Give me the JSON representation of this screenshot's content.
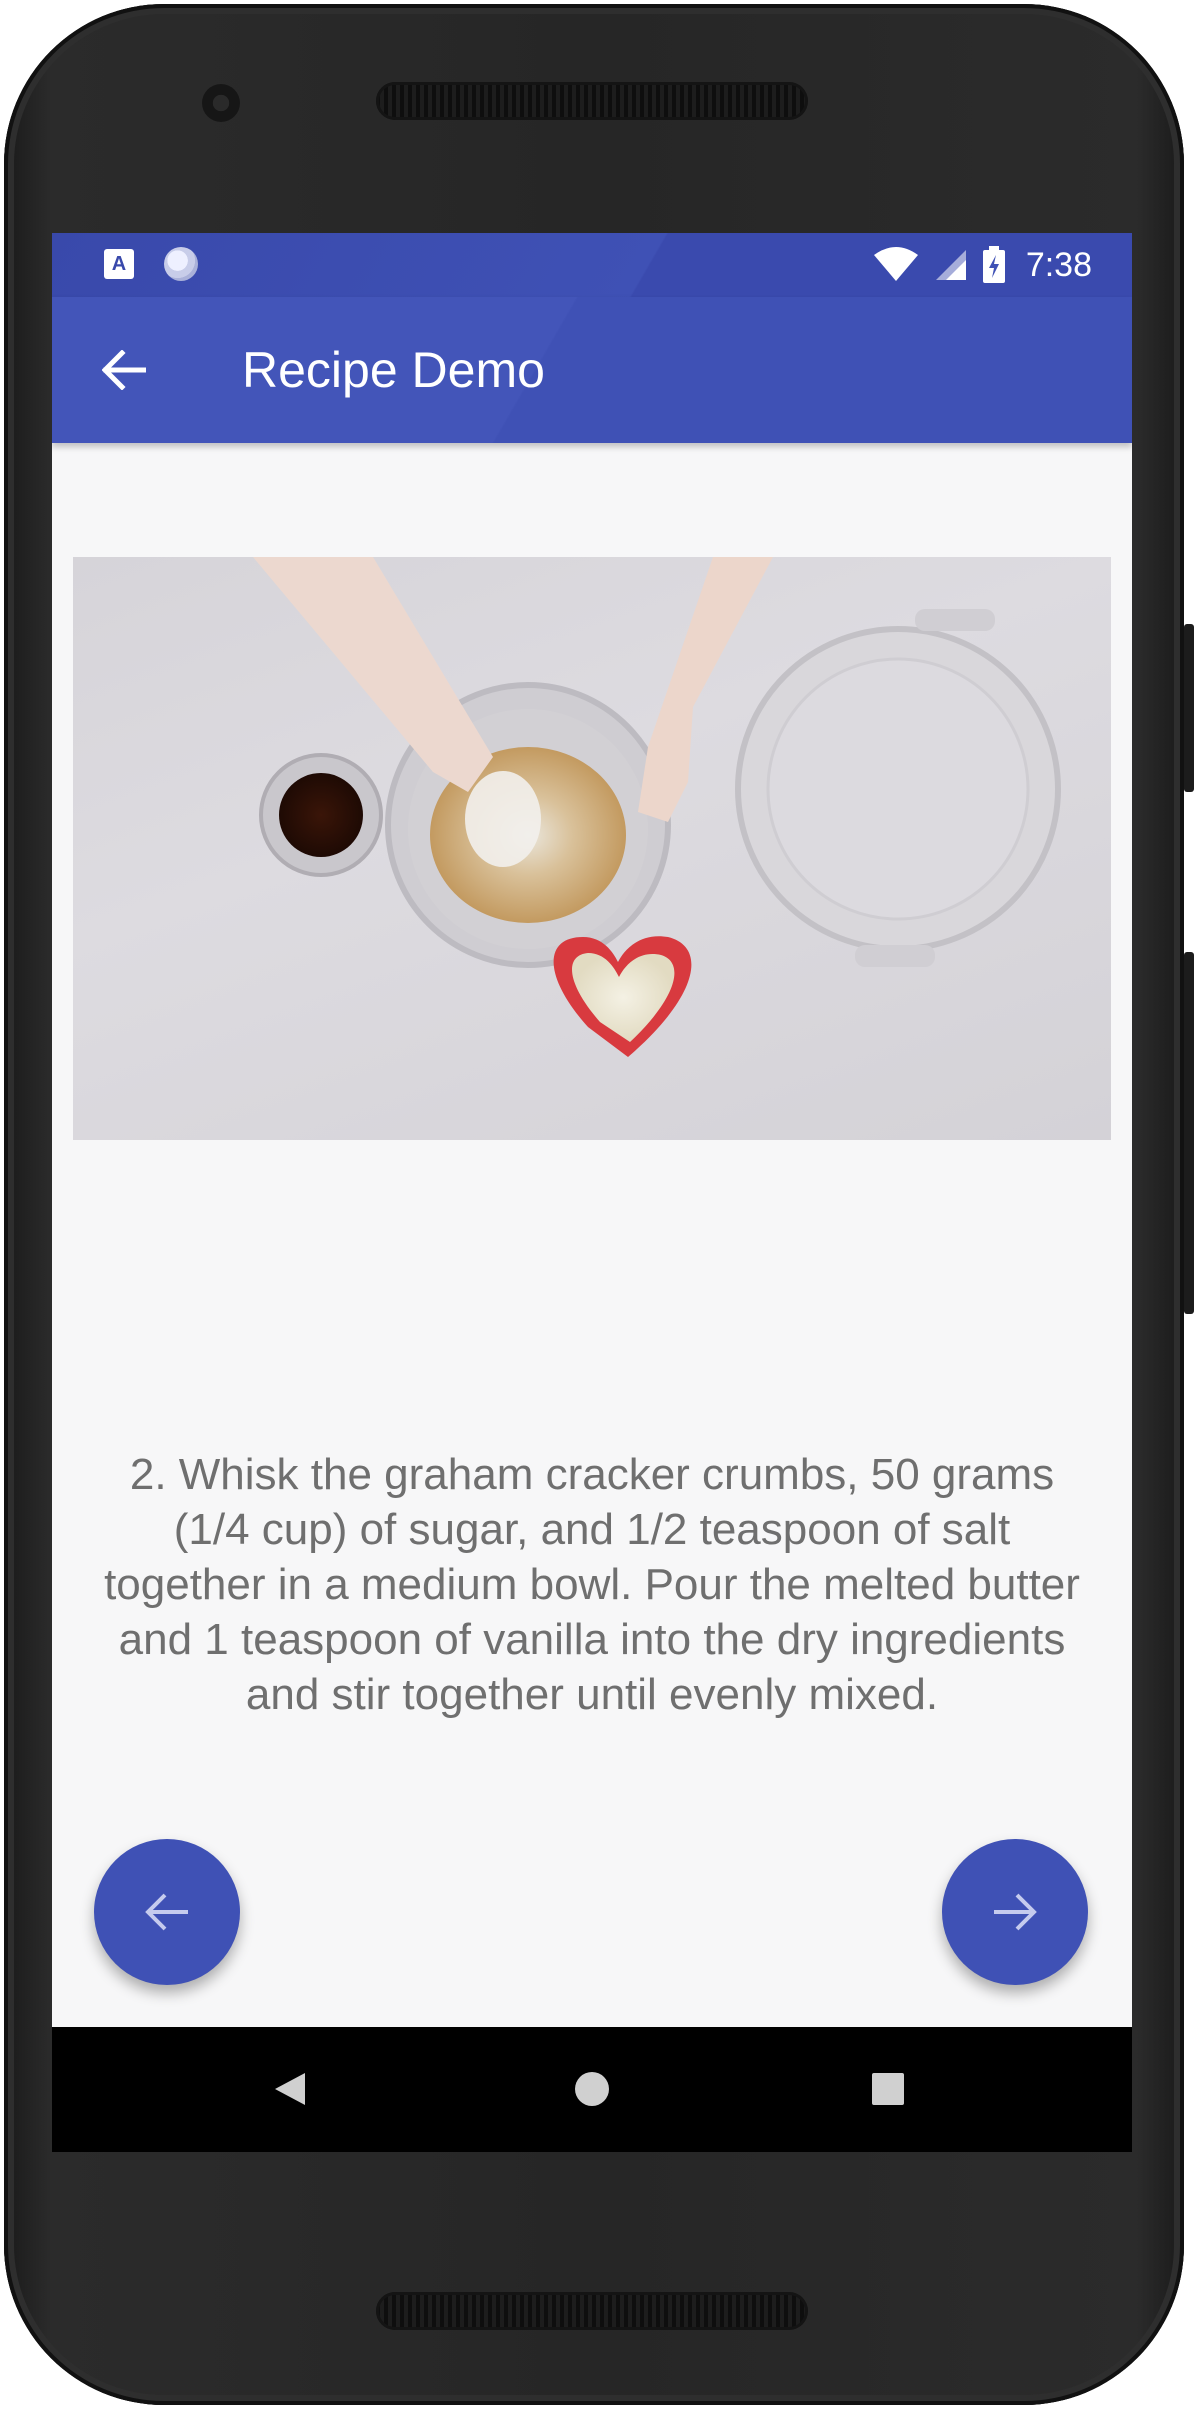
{
  "status_bar": {
    "time": "7:38",
    "left_icons": [
      "text-a-icon",
      "sync-icon"
    ],
    "right_icons": [
      "wifi-icon",
      "cell-signal-icon",
      "battery-charging-icon"
    ],
    "notification_letter": "A"
  },
  "toolbar": {
    "title": "Recipe Demo",
    "back_icon": "arrow-back-icon"
  },
  "step": {
    "text": "2. Whisk the graham cracker crumbs, 50 grams (1/4 cup) of sugar, and 1/2 teaspoon of salt together in a medium bowl. Pour the melted butter and 1 teaspoon of vanilla into the dry ingredients and stir together until evenly mixed."
  },
  "navigation": {
    "prev_icon": "arrow-left-icon",
    "next_icon": "arrow-right-icon"
  },
  "system_nav": {
    "back_icon": "nav-back-icon",
    "home_icon": "nav-home-icon",
    "recents_icon": "nav-recents-icon"
  },
  "colors": {
    "primary": "#3f51b5",
    "primary_dark": "#3949ab",
    "background": "#f7f7f8",
    "text": "#6f6f6f"
  }
}
